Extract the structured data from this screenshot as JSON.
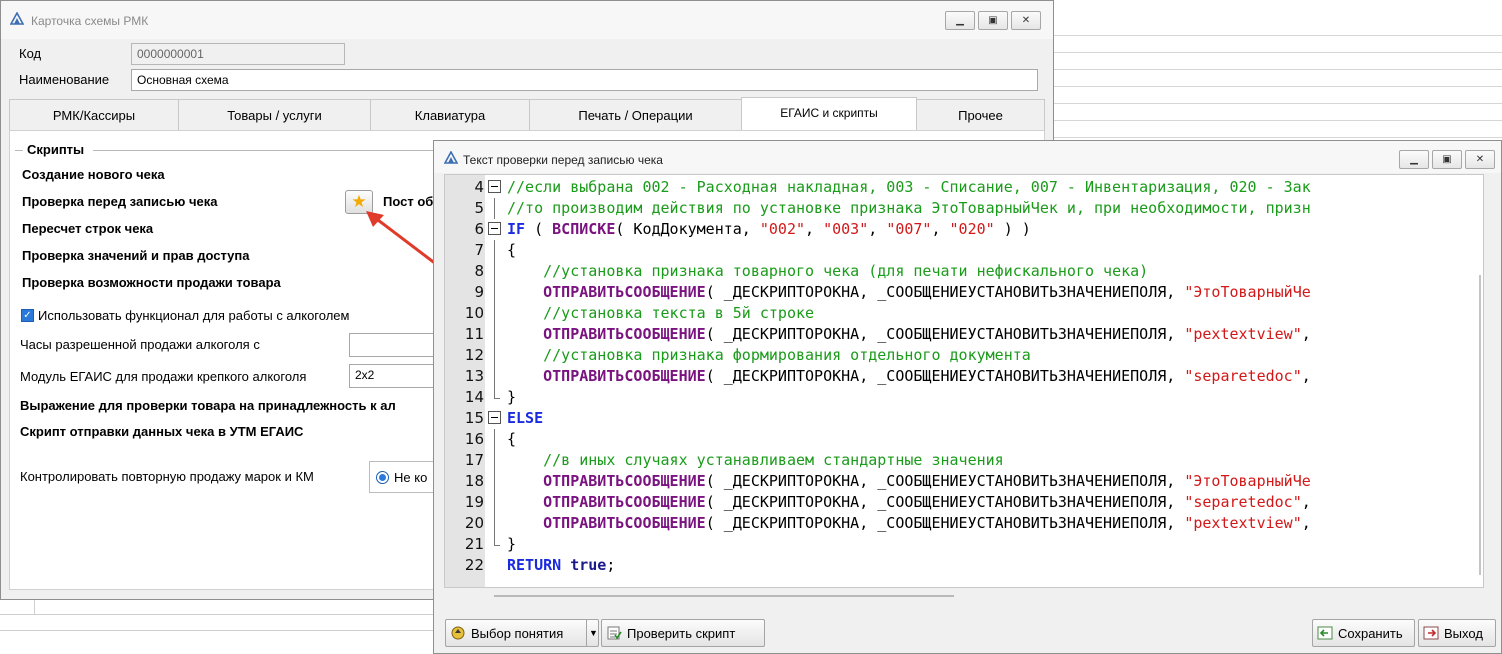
{
  "main_window": {
    "title": "Карточка схемы РМК",
    "code_label": "Код",
    "code_value": "0000000001",
    "name_label": "Наименование",
    "name_value": "Основная схема",
    "tabs": [
      "РМК/Кассиры",
      "Товары / услуги",
      "Клавиатура",
      "Печать / Операции",
      "ЕГАИС и скрипты",
      "Прочее"
    ],
    "active_tab": "ЕГАИС и скрипты",
    "group_title": "Скрипты",
    "scripts": [
      "Создание нового чека",
      "Проверка перед записью чека",
      "Пересчет строк чека",
      "Проверка значений и прав доступа",
      "Проверка возможности продажи товара"
    ],
    "post_label_partial": "Пост об",
    "alcohol_checkbox_label": "Использовать функционал для работы с алкоголем",
    "alcohol_checked": true,
    "hours_label": "Часы разрешенной продажи алкоголя с",
    "egais_module_label": "Модуль ЕГАИС для продажи крепкого алкоголя",
    "egais_module_value": "2x2",
    "expression_label": "Выражение для проверки товара на принадлежность к ал",
    "utm_script_label": "Скрипт отправки данных чека в УТМ ЕГАИС",
    "marks_label": "Контролировать повторную продажу марок и КМ",
    "marks_radio_value": "Не ко"
  },
  "code_window": {
    "title": "Текст проверки перед записью чека",
    "lines": [
      {
        "n": "4",
        "fold": "open",
        "parts": [
          {
            "t": "//если выбрана 002 - Расходная накладная, 003 - Списание, 007 - Инвентаризация, 020 - Зак",
            "c": "com"
          }
        ]
      },
      {
        "n": "5",
        "fold": "line",
        "parts": [
          {
            "t": "//то производим действия по установке признака ЭтоТоварныйЧек и, при необходимости, призн",
            "c": "com"
          }
        ]
      },
      {
        "n": "6",
        "fold": "open",
        "parts": [
          {
            "t": "IF",
            "c": "kw"
          },
          {
            "t": " ( ",
            "c": ""
          },
          {
            "t": "ВСПИСКЕ",
            "c": "fn"
          },
          {
            "t": "( КодДокумента, ",
            "c": ""
          },
          {
            "t": "\"002\"",
            "c": "str"
          },
          {
            "t": ", ",
            "c": ""
          },
          {
            "t": "\"003\"",
            "c": "str"
          },
          {
            "t": ", ",
            "c": ""
          },
          {
            "t": "\"007\"",
            "c": "str"
          },
          {
            "t": ", ",
            "c": ""
          },
          {
            "t": "\"020\"",
            "c": "str"
          },
          {
            "t": " ) )",
            "c": ""
          }
        ]
      },
      {
        "n": "7",
        "fold": "line",
        "parts": [
          {
            "t": "{",
            "c": ""
          }
        ]
      },
      {
        "n": "8",
        "fold": "line",
        "parts": [
          {
            "t": "    ",
            "c": ""
          },
          {
            "t": "//установка признака товарного чека (для печати нефискального чека)",
            "c": "com"
          }
        ]
      },
      {
        "n": "9",
        "fold": "line",
        "parts": [
          {
            "t": "    ",
            "c": ""
          },
          {
            "t": "ОТПРАВИТЬСООБЩЕНИЕ",
            "c": "fn"
          },
          {
            "t": "( _ДЕСКРИПТОРОКНА, _СООБЩЕНИЕУСТАНОВИТЬЗНАЧЕНИЕПОЛЯ, ",
            "c": ""
          },
          {
            "t": "\"ЭтоТоварныйЧе",
            "c": "str"
          }
        ]
      },
      {
        "n": "10",
        "fold": "line",
        "parts": [
          {
            "t": "    ",
            "c": ""
          },
          {
            "t": "//установка текста в 5й строке",
            "c": "com"
          }
        ]
      },
      {
        "n": "11",
        "fold": "line",
        "parts": [
          {
            "t": "    ",
            "c": ""
          },
          {
            "t": "ОТПРАВИТЬСООБЩЕНИЕ",
            "c": "fn"
          },
          {
            "t": "( _ДЕСКРИПТОРОКНА, _СООБЩЕНИЕУСТАНОВИТЬЗНАЧЕНИЕПОЛЯ, ",
            "c": ""
          },
          {
            "t": "\"pextextview\"",
            "c": "str"
          },
          {
            "t": ",",
            "c": ""
          }
        ]
      },
      {
        "n": "12",
        "fold": "line",
        "parts": [
          {
            "t": "    ",
            "c": ""
          },
          {
            "t": "//установка признака формирования отдельного документа",
            "c": "com"
          }
        ]
      },
      {
        "n": "13",
        "fold": "line",
        "parts": [
          {
            "t": "    ",
            "c": ""
          },
          {
            "t": "ОТПРАВИТЬСООБЩЕНИЕ",
            "c": "fn"
          },
          {
            "t": "( _ДЕСКРИПТОРОКНА, _СООБЩЕНИЕУСТАНОВИТЬЗНАЧЕНИЕПОЛЯ, ",
            "c": ""
          },
          {
            "t": "\"separetedoc\"",
            "c": "str"
          },
          {
            "t": ",",
            "c": ""
          }
        ]
      },
      {
        "n": "14",
        "fold": "end",
        "parts": [
          {
            "t": "}",
            "c": ""
          }
        ]
      },
      {
        "n": "15",
        "fold": "open",
        "parts": [
          {
            "t": "ELSE",
            "c": "kw"
          }
        ]
      },
      {
        "n": "16",
        "fold": "line",
        "parts": [
          {
            "t": "{",
            "c": ""
          }
        ]
      },
      {
        "n": "17",
        "fold": "line",
        "parts": [
          {
            "t": "    ",
            "c": ""
          },
          {
            "t": "//в иных случаях устанавливаем стандартные значения",
            "c": "com"
          }
        ]
      },
      {
        "n": "18",
        "fold": "line",
        "parts": [
          {
            "t": "    ",
            "c": ""
          },
          {
            "t": "ОТПРАВИТЬСООБЩЕНИЕ",
            "c": "fn"
          },
          {
            "t": "( _ДЕСКРИПТОРОКНА, _СООБЩЕНИЕУСТАНОВИТЬЗНАЧЕНИЕПОЛЯ, ",
            "c": ""
          },
          {
            "t": "\"ЭтоТоварныйЧе",
            "c": "str"
          }
        ]
      },
      {
        "n": "19",
        "fold": "line",
        "parts": [
          {
            "t": "    ",
            "c": ""
          },
          {
            "t": "ОТПРАВИТЬСООБЩЕНИЕ",
            "c": "fn"
          },
          {
            "t": "( _ДЕСКРИПТОРОКНА, _СООБЩЕНИЕУСТАНОВИТЬЗНАЧЕНИЕПОЛЯ, ",
            "c": ""
          },
          {
            "t": "\"separetedoc\"",
            "c": "str"
          },
          {
            "t": ",",
            "c": ""
          }
        ]
      },
      {
        "n": "20",
        "fold": "line",
        "parts": [
          {
            "t": "    ",
            "c": ""
          },
          {
            "t": "ОТПРАВИТЬСООБЩЕНИЕ",
            "c": "fn"
          },
          {
            "t": "( _ДЕСКРИПТОРОКНА, _СООБЩЕНИЕУСТАНОВИТЬЗНАЧЕНИЕПОЛЯ, ",
            "c": ""
          },
          {
            "t": "\"pextextview\"",
            "c": "str"
          },
          {
            "t": ",",
            "c": ""
          }
        ]
      },
      {
        "n": "21",
        "fold": "end",
        "parts": [
          {
            "t": "}",
            "c": ""
          }
        ]
      },
      {
        "n": "22",
        "fold": "none",
        "parts": [
          {
            "t": "RETURN",
            "c": "kw"
          },
          {
            "t": " ",
            "c": ""
          },
          {
            "t": "true",
            "c": "dk"
          },
          {
            "t": ";",
            "c": ""
          }
        ]
      }
    ],
    "buttons": {
      "concept": "Выбор понятия",
      "check": "Проверить скрипт",
      "save": "Сохранить",
      "exit": "Выход"
    }
  },
  "colors": {
    "comment": "#1a9b1a",
    "keyword": "#1a2bdf",
    "function": "#7a1380",
    "string": "#d21818",
    "annotation_arrow": "#e03a2a"
  }
}
